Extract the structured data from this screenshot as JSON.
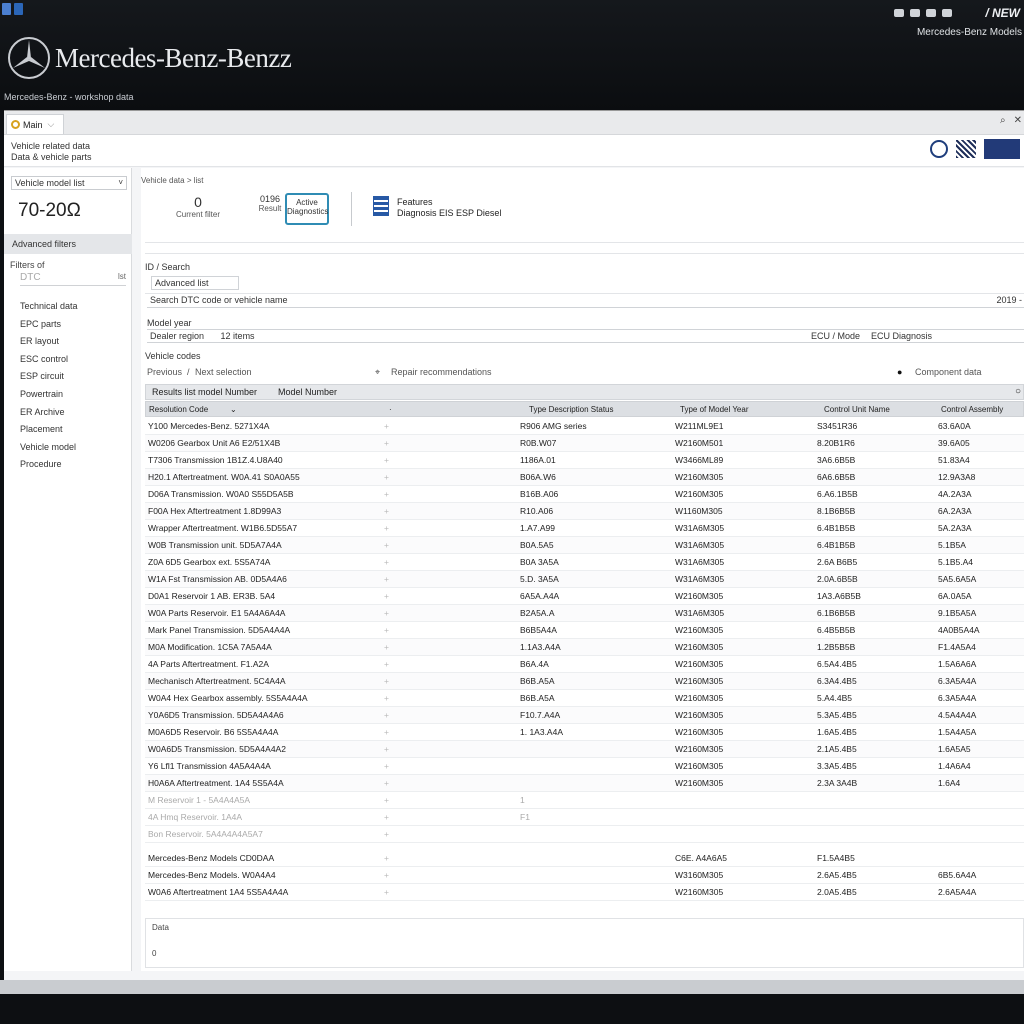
{
  "topbar": {
    "brand": "Mercedes-Benz-Benzz",
    "tagline": "Mercedes-Benz - workshop data",
    "right_title": "/ NEW",
    "right_subtitle": "Mercedes-Benz Models"
  },
  "tab": {
    "label": "Main"
  },
  "header": {
    "line1": "Vehicle related data",
    "line2": "Data & vehicle parts"
  },
  "sidebar": {
    "select_value": "Vehicle model list",
    "big_value": "70-20Ω",
    "section": "Advanced filters",
    "filter_label": "Filters of",
    "filter_input": "DTC",
    "filter_key": "lst",
    "items": [
      "Technical data",
      "EPC parts",
      "ER layout",
      "ESC control",
      "ESP circuit",
      "Powertrain",
      "ER Archive",
      "Placement",
      "Vehicle model",
      "Procedure"
    ]
  },
  "content": {
    "crumb": "Vehicle data > list",
    "card1_num": "0",
    "card1_label": "Current filter",
    "card2_num": "0196",
    "card2_label": "Result",
    "card3_line1": "Active",
    "card3_line2": "Diagnostics",
    "card4_line1": "Features",
    "card4_line2": "Diagnosis EIS ESP Diesel",
    "label_a": "ID / Search",
    "input_a": "Advanced list",
    "input_b": "Search DTC code or vehicle name",
    "input_b_right": "2019 -",
    "label_c": "Model year",
    "input_c_left": "Dealer region",
    "input_c_mid": "12 items",
    "input_c_right_label": "ECU / Mode",
    "input_c_right": "ECU Diagnosis",
    "label_d": "Vehicle codes",
    "radio_a": "Previous",
    "radio_a_slash": "/",
    "radio_b": "Next selection",
    "radio_c": "Repair recommendations",
    "radio_d": "Component data"
  },
  "table": {
    "toolbar_left": "Results list model Number",
    "toolbar_mid": "Model Number",
    "headers": [
      "Resolution Code",
      "Type Description Status",
      "Type of Model Year",
      "Control Unit Name",
      "Control Assembly"
    ],
    "rows": [
      [
        "Y100 Mercedes-Benz. 5271X4A",
        "R906 AMG series",
        "W211ML9E1",
        "S3451R36",
        "63.6A0A"
      ],
      [
        "W0206 Gearbox Unit A6 E2/51X4B",
        "R0B.W07",
        "W2160M501",
        "8.20B1R6",
        "39.6A05"
      ],
      [
        "T7306 Transmission 1B1Z.4.U8A40",
        "1186A.01",
        "W3466ML89",
        "3A6.6B5B",
        "51.83A4"
      ],
      [
        "H20.1 Aftertreatment. W0A.41 S0A0A55",
        "B06A.W6",
        "W2160M305",
        "6A6.6B5B",
        "12.9A3A8"
      ],
      [
        "D06A Transmission. W0A0 S55D5A5B",
        "B16B.A06",
        "W2160M305",
        "6.A6.1B5B",
        "4A.2A3A"
      ],
      [
        "F00A Hex Aftertreatment 1.8D99A3",
        "R10.A06",
        "W1160M305",
        "8.1B6B5B",
        "6A.2A3A"
      ],
      [
        "Wrapper Aftertreatment. W1B6.5D55A7",
        "1.A7.A99",
        "W31A6M305",
        "6.4B1B5B",
        "5A.2A3A"
      ],
      [
        "W0B Transmission unit. 5D5A7A4A",
        "B0A.5A5",
        "W31A6M305",
        "6.4B1B5B",
        "5.1B5A"
      ],
      [
        "Z0A 6D5 Gearbox ext. 5S5A74A",
        "B0A 3A5A",
        "W31A6M305",
        "2.6A B6B5",
        "5.1B5.A4"
      ],
      [
        "W1A Fst Transmission AB. 0D5A4A6",
        "5.D. 3A5A",
        "W31A6M305",
        "2.0A.6B5B",
        "5A5.6A5A"
      ],
      [
        "D0A1 Reservoir 1 AB. ER3B. 5A4",
        "6A5A.A4A",
        "W2160M305",
        "1A3.A6B5B",
        "6A.0A5A"
      ],
      [
        "W0A Parts Reservoir. E1 5A4A6A4A",
        "B2A5A.A",
        "W31A6M305",
        "6.1B6B5B",
        "9.1B5A5A"
      ],
      [
        "Mark Panel Transmission. 5D5A4A4A",
        "B6B5A4A",
        "W2160M305",
        "6.4B5B5B",
        "4A0B5A4A"
      ],
      [
        "M0A Modification. 1C5A 7A5A4A",
        "1.1A3.A4A",
        "W2160M305",
        "1.2B5B5B",
        "F1.4A5A4"
      ],
      [
        "4A Parts Aftertreatment. F1.A2A",
        "B6A.4A",
        "W2160M305",
        "6.5A4.4B5",
        "1.5A6A6A"
      ],
      [
        "Mechanisch Aftertreatment. 5C4A4A",
        "B6B.A5A",
        "W2160M305",
        "6.3A4.4B5",
        "6.3A5A4A"
      ],
      [
        "W0A4 Hex Gearbox assembly. 5S5A4A4A",
        "B6B.A5A",
        "W2160M305",
        "5.A4.4B5",
        "6.3A5A4A"
      ],
      [
        "Y0A6D5 Transmission. 5D5A4A4A6",
        "F10.7.A4A",
        "W2160M305",
        "5.3A5.4B5",
        "4.5A4A4A"
      ],
      [
        "M0A6D5 Reservoir. B6 5S5A4A4A",
        "1. 1A3.A4A",
        "W2160M305",
        "1.6A5.4B5",
        "1.5A4A5A"
      ],
      [
        "W0A6D5 Transmission. 5D5A4A4A2",
        "",
        "W2160M305",
        "2.1A5.4B5",
        "1.6A5A5"
      ],
      [
        "Y6 Lfl1 Transmission 4A5A4A4A",
        "",
        "W2160M305",
        "3.3A5.4B5",
        "1.4A6A4"
      ],
      [
        "H0A6A Aftertreatment. 1A4 5S5A4A",
        "",
        "W2160M305",
        "2.3A 3A4B",
        "1.6A4"
      ]
    ],
    "faded_rows": [
      [
        "M Reservoir 1 - 5A4A4A5A",
        "1"
      ],
      [
        "4A Hmq Reservoir. 1A4A",
        "F1"
      ],
      [
        "Bon Reservoir. 5A4A4A4A5A7",
        ""
      ]
    ],
    "bottom_rows": [
      [
        "Mercedes-Benz Models CD0DAA",
        "",
        "C6E. A4A6A5",
        "F1.5A4B5",
        ""
      ],
      [
        "Mercedes-Benz Models. W0A4A4",
        "",
        "W3160M305",
        "2.6A5.4B5",
        "6B5.6A4A"
      ],
      [
        "W0A6 Aftertreatment 1A4 5S5A4A4A",
        "",
        "W2160M305",
        "2.0A5.4B5",
        "2.6A5A4A"
      ]
    ],
    "footer_label": "Data",
    "footer_value": "0"
  }
}
